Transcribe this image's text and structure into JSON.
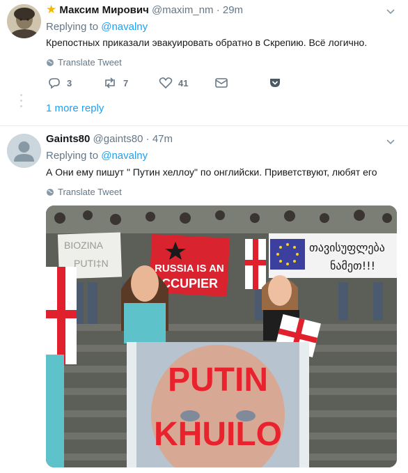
{
  "tweets": [
    {
      "name": "Максим Мирович",
      "handle": "@maxim_nm",
      "separator": "·",
      "time": "29m",
      "replying_prefix": "Replying to",
      "replying_to": "@navalny",
      "text": "Крепостных приказали эвакуировать обратно в Скрепию. Всё логично.",
      "translate_label": "Translate Tweet",
      "reply_count": "3",
      "retweet_count": "7",
      "like_count": "41"
    },
    {
      "name": "Gaints80",
      "handle": "@gaints80",
      "separator": "·",
      "time": "47m",
      "replying_prefix": "Replying to",
      "replying_to": "@navalny",
      "text": "А  Они ему пишут \" Путин хеллоу\" по онглийски. Приветствуют, любят его",
      "translate_label": "Translate Tweet"
    }
  ],
  "more_reply_label": "1 more reply",
  "photo": {
    "sign_biozina": "BIOZINA",
    "sign_putin_small": "PUTI‡N",
    "banner_russia_line1": "RUSSIA IS AN",
    "banner_russia_line2": "OCCUPIER",
    "banner_georgian_line1": "თავისუფლება",
    "banner_georgian_line2": "ნამეთ!!!",
    "poster_line1": "PUTIN",
    "poster_line2": "KHUILO"
  },
  "colors": {
    "accent": "#1da1f2",
    "muted": "#657786",
    "star": "#f5b800"
  }
}
